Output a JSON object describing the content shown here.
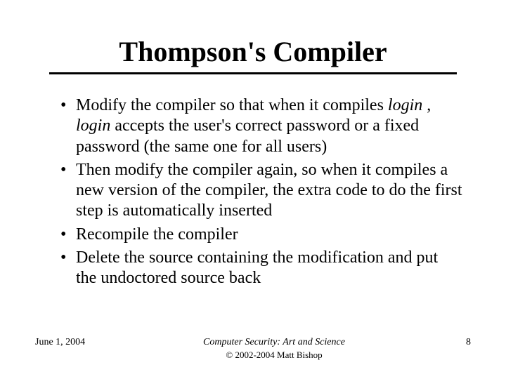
{
  "title": "Thompson's Compiler",
  "bullets": [
    {
      "pre": "Modify the compiler so that when it compiles ",
      "it1": "login",
      "mid": " , ",
      "it2": "login",
      "post": " accepts the user's correct password or a fixed password (the same one for all users)"
    },
    {
      "pre": "Then modify the compiler again, so when it compiles a new version of the compiler, the extra code to do the first step is automatically inserted",
      "it1": "",
      "mid": "",
      "it2": "",
      "post": ""
    },
    {
      "pre": "Recompile the compiler",
      "it1": "",
      "mid": "",
      "it2": "",
      "post": ""
    },
    {
      "pre": "Delete the source containing the modification and put the undoctored source back",
      "it1": "",
      "mid": "",
      "it2": "",
      "post": ""
    }
  ],
  "footer": {
    "date": "June 1, 2004",
    "booktitle": "Computer Security: Art and Science",
    "copyright": "© 2002-2004 Matt Bishop",
    "page": "8"
  }
}
